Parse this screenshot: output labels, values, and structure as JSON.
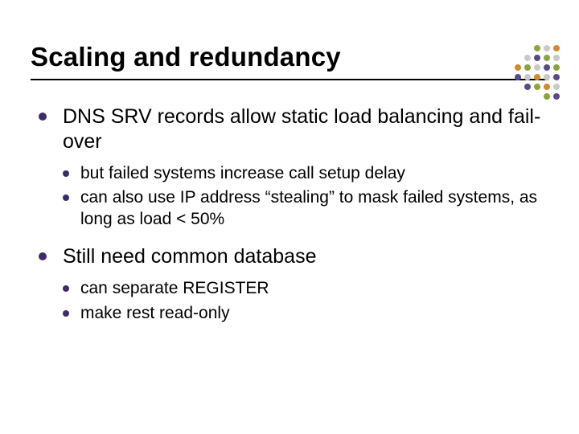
{
  "title": "Scaling and redundancy",
  "bullets": [
    {
      "text": "DNS SRV records allow static load balancing and fail-over",
      "sub": [
        "but failed systems increase call setup delay",
        "can also use IP address “stealing” to mask failed systems, as long as load < 50%"
      ]
    },
    {
      "text": "Still need common database",
      "sub": [
        "can separate REGISTER",
        "make rest read-only"
      ]
    }
  ],
  "dot_colors": {
    "green": "#8aa53b",
    "violet": "#5a4a8a",
    "orange": "#d08a2a",
    "gray": "#c9c9c9"
  }
}
